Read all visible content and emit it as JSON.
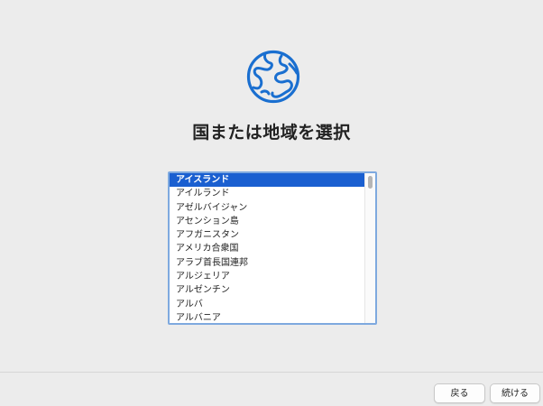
{
  "header": {
    "icon": "globe-icon",
    "title": "国または地域を選択"
  },
  "country_list": {
    "selected_index": 0,
    "items": [
      "アイスランド",
      "アイルランド",
      "アゼルバイジャン",
      "アセンション島",
      "アフガニスタン",
      "アメリカ合衆国",
      "アラブ首長国連邦",
      "アルジェリア",
      "アルゼンチン",
      "アルバ",
      "アルバニア"
    ]
  },
  "footer": {
    "back_label": "戻る",
    "continue_label": "続ける"
  },
  "colors": {
    "accent": "#1a5fd0",
    "background": "#ececec"
  }
}
